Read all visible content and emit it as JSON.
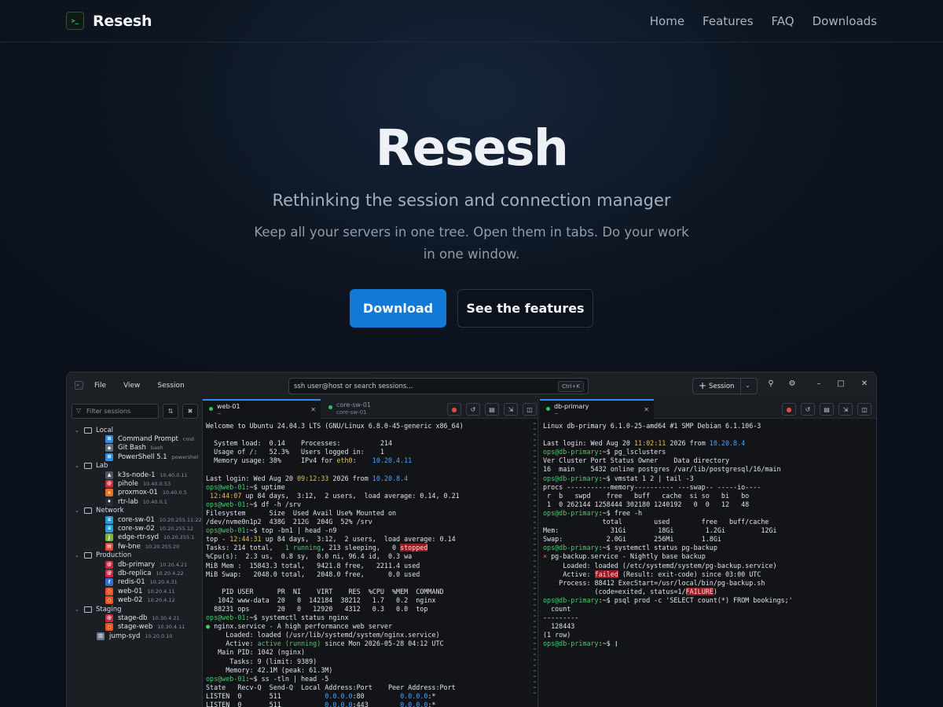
{
  "nav": {
    "brand": "Resesh",
    "logo_glyph": ">_",
    "links": [
      "Home",
      "Features",
      "FAQ",
      "Downloads"
    ]
  },
  "hero": {
    "title": "Resesh",
    "subtitle": "Rethinking the session and connection manager",
    "description": "Keep all your servers in one tree. Open them in tabs. Do your work in one window.",
    "primary_button": "Download",
    "secondary_button": "See the features"
  },
  "colors": {
    "accent": "#1179d7",
    "prompt_green": "#3ecf6e",
    "path_blue": "#4aa3ff",
    "error_red": "#ff5a5f"
  },
  "app": {
    "menu": [
      "File",
      "View",
      "Session"
    ],
    "search_placeholder": "ssh user@host or search sessions...",
    "search_shortcut": "Ctrl+K",
    "session_button": "Session",
    "toolbar_icons": [
      "pin-icon",
      "gear-icon",
      "minimize-icon",
      "maximize-icon",
      "close-icon"
    ],
    "filter_placeholder": "Filter sessions",
    "tree": [
      {
        "type": "group",
        "name": "Local"
      },
      {
        "type": "item",
        "name": "Command Prompt",
        "detail": "cmd",
        "icon": "windows-icon",
        "color": "#2f8be6"
      },
      {
        "type": "item",
        "name": "Git Bash",
        "detail": "bash",
        "icon": "git-bash-icon",
        "color": "#5f7186"
      },
      {
        "type": "item",
        "name": "PowerShell 5.1",
        "detail": "powershel",
        "icon": "windows-icon",
        "color": "#2f8be6"
      },
      {
        "type": "group",
        "name": "Lab"
      },
      {
        "type": "item",
        "name": "k3s-node-1",
        "detail": "10.40.0.11",
        "icon": "linux-icon",
        "color": "#4c5563"
      },
      {
        "type": "item",
        "name": "pihole",
        "detail": "10.40.0.53",
        "icon": "debian-icon",
        "color": "#c8283f"
      },
      {
        "type": "item",
        "name": "proxmox-01",
        "detail": "10.40.0.5",
        "icon": "proxmox-icon",
        "color": "#e8711f"
      },
      {
        "type": "item",
        "name": "rtr-lab",
        "detail": "10.40.0.1",
        "icon": "bsd-icon",
        "color": "#2a2d33"
      },
      {
        "type": "group",
        "name": "Network"
      },
      {
        "type": "item",
        "name": "core-sw-01",
        "detail": "10.20.255.11:22",
        "icon": "switch-icon",
        "color": "#2a9ad8"
      },
      {
        "type": "item",
        "name": "core-sw-02",
        "detail": "10.20.255.12",
        "icon": "switch-icon",
        "color": "#2a9ad8"
      },
      {
        "type": "item",
        "name": "edge-rtr-syd",
        "detail": "10.20.255.1",
        "icon": "juniper-icon",
        "color": "#7bb241"
      },
      {
        "type": "item",
        "name": "fw-bne",
        "detail": "10.20.255.20",
        "icon": "firewall-icon",
        "color": "#e2483c"
      },
      {
        "type": "group",
        "name": "Production"
      },
      {
        "type": "item",
        "name": "db-primary",
        "detail": "10.20.4.21",
        "icon": "debian-icon",
        "color": "#c8283f"
      },
      {
        "type": "item",
        "name": "db-replica",
        "detail": "10.20.4.22",
        "icon": "debian-icon",
        "color": "#c8283f"
      },
      {
        "type": "item",
        "name": "redis-01",
        "detail": "10.20.4.31",
        "icon": "fedora-icon",
        "color": "#2e6fd1"
      },
      {
        "type": "item",
        "name": "web-01",
        "detail": "10.20.4.11",
        "icon": "ubuntu-icon",
        "color": "#e95420"
      },
      {
        "type": "item",
        "name": "web-02",
        "detail": "10.20.4.12",
        "icon": "ubuntu-icon",
        "color": "#e95420"
      },
      {
        "type": "group",
        "name": "Staging"
      },
      {
        "type": "item",
        "name": "stage-db",
        "detail": "10.30.4.21",
        "icon": "debian-icon",
        "color": "#c8283f"
      },
      {
        "type": "item",
        "name": "stage-web",
        "detail": "10.30.4.11",
        "icon": "ubuntu-icon",
        "color": "#e95420"
      },
      {
        "type": "item",
        "name": "jump-syd",
        "detail": "10.20.0.10",
        "icon": "server-icon",
        "color": "#6b7b90"
      }
    ],
    "left_tabs": [
      {
        "name": "web-01",
        "sub": "~",
        "active": true
      },
      {
        "name": "core-sw-01",
        "sub": "core-sw-01",
        "active": false
      }
    ],
    "right_tabs": [
      {
        "name": "db-primary",
        "sub": "~",
        "active": true
      }
    ],
    "left_terminal": [
      [
        [
          "Welcome to Ubuntu 24.04.3 LTS (GNU/Linux 6.8.0-45-generic x86_64)",
          ""
        ]
      ],
      [
        [
          "",
          ""
        ]
      ],
      [
        [
          "  System load:  0.14    Processes:          214",
          ""
        ]
      ],
      [
        [
          "  Usage of /:   52.3%   Users logged in:    1",
          ""
        ]
      ],
      [
        [
          "  Memory usage: 38%     IPv4 for ",
          ""
        ],
        [
          "eth0",
          "y"
        ],
        [
          ":    ",
          ""
        ],
        [
          "10.20.4.11",
          "b"
        ]
      ],
      [
        [
          "",
          ""
        ]
      ],
      [
        [
          "Last login: Wed Aug 20 ",
          ""
        ],
        [
          "09:12:33",
          "y"
        ],
        [
          " 2026 from ",
          ""
        ],
        [
          "10.20.8.4",
          "b"
        ]
      ],
      [
        [
          "ops@web-01",
          "g"
        ],
        [
          ":~$ uptime",
          ""
        ]
      ],
      [
        [
          " 12:44:07 ",
          "y"
        ],
        [
          "up 84 days,  3:12,  2 users,  load average: 0.14, 0.21",
          ""
        ]
      ],
      [
        [
          "ops@web-01",
          "g"
        ],
        [
          ":~$ df -h /srv",
          ""
        ]
      ],
      [
        [
          "Filesystem      Size  Used Avail Use% Mounted on",
          ""
        ]
      ],
      [
        [
          "/dev/nvme0n1p2  438G  212G  204G  52% /srv",
          ""
        ]
      ],
      [
        [
          "ops@web-01",
          "g"
        ],
        [
          ":~$ top -bn1 | head -n9",
          ""
        ]
      ],
      [
        [
          "top - ",
          ""
        ],
        [
          "12:44:31",
          "y"
        ],
        [
          " up 84 days,  3:12,  2 users,  load average: 0.14",
          ""
        ]
      ],
      [
        [
          "Tasks: 214 total,   ",
          ""
        ],
        [
          "1 running",
          "g"
        ],
        [
          ", 213 sleeping,   0 ",
          ""
        ],
        [
          "stopped",
          "rb"
        ]
      ],
      [
        [
          "%Cpu(s):  2.3 us,  0.8 sy,  0.0 ni, 96.4 id,  0.3 wa",
          ""
        ]
      ],
      [
        [
          "MiB Mem :  15843.3 total,   9421.8 free,   2211.4 used",
          ""
        ]
      ],
      [
        [
          "MiB Swap:   2048.0 total,   2048.0 free,      0.0 used",
          ""
        ]
      ],
      [
        [
          "",
          ""
        ]
      ],
      [
        [
          "    PID USER      PR  NI    VIRT    RES  %CPU  %MEM  COMMAND",
          ""
        ]
      ],
      [
        [
          "   1042 www-data  20   0  142184  38212   1.7   0.2  nginx",
          ""
        ]
      ],
      [
        [
          "  88231 ops       20   0   12920   4312   0.3   0.0  top",
          ""
        ]
      ],
      [
        [
          "ops@web-01",
          "g"
        ],
        [
          ":~$ systemctl status nginx",
          ""
        ]
      ],
      [
        [
          "●",
          "g"
        ],
        [
          " nginx.service - A high performance web server",
          ""
        ]
      ],
      [
        [
          "     Loaded: loaded (/usr/lib/systemd/system/nginx.service)",
          ""
        ]
      ],
      [
        [
          "     Active: ",
          ""
        ],
        [
          "active (running)",
          "g"
        ],
        [
          " since Mon 2026-05-28 04:12 UTC",
          ""
        ]
      ],
      [
        [
          "   Main PID: 1042 (nginx)",
          ""
        ]
      ],
      [
        [
          "      Tasks: 9 (limit: 9389)",
          ""
        ]
      ],
      [
        [
          "     Memory: 42.1M (peak: 61.3M)",
          ""
        ]
      ],
      [
        [
          "ops@web-01",
          "g"
        ],
        [
          ":~$ ss -tln | head -5",
          ""
        ]
      ],
      [
        [
          "State   Recv-Q  Send-Q  Local Address:Port    Peer Address:Port",
          ""
        ]
      ],
      [
        [
          "LISTEN  0       511           ",
          ""
        ],
        [
          "0.0.0.0",
          "b"
        ],
        [
          ":80         ",
          ""
        ],
        [
          "0.0.0.0",
          "b"
        ],
        [
          ":*",
          ""
        ]
      ],
      [
        [
          "LISTEN  0       511           ",
          ""
        ],
        [
          "0.0.0.0",
          "b"
        ],
        [
          ":443        ",
          ""
        ],
        [
          "0.0.0.0",
          "b"
        ],
        [
          ":*",
          ""
        ]
      ]
    ],
    "right_terminal": [
      [
        [
          "Linux db-primary 6.1.0-25-amd64 #1 SMP Debian 6.1.106-3",
          ""
        ]
      ],
      [
        [
          "",
          ""
        ]
      ],
      [
        [
          "Last login: Wed Aug 20 ",
          ""
        ],
        [
          "11:02:11",
          "y"
        ],
        [
          " 2026 from ",
          ""
        ],
        [
          "10.20.8.4",
          "b"
        ]
      ],
      [
        [
          "ops@db-primary",
          "g"
        ],
        [
          ":~$ pg_lsclusters",
          ""
        ]
      ],
      [
        [
          "Ver Cluster Port Status Owner    Data directory",
          ""
        ]
      ],
      [
        [
          "16  main    5432 online postgres /var/lib/postgresql/16/main",
          ""
        ]
      ],
      [
        [
          "ops@db-primary",
          "g"
        ],
        [
          ":~$ vmstat 1 2 | tail -3",
          ""
        ]
      ],
      [
        [
          "procs -----------memory---------- ---swap-- -----io----",
          ""
        ]
      ],
      [
        [
          " r  b   swpd    free   buff   cache  si so   bi   bo",
          ""
        ]
      ],
      [
        [
          " 1  0 262144 1258444 302180 1240192   0  0   12   48",
          ""
        ]
      ],
      [
        [
          "ops@db-primary",
          "g"
        ],
        [
          ":~$ free -h",
          ""
        ]
      ],
      [
        [
          "               total        used        free   buff/cache",
          ""
        ]
      ],
      [
        [
          "Mem:             31Gi        18Gi        1.2Gi         12Gi",
          ""
        ]
      ],
      [
        [
          "Swap:           2.0Gi       256Mi       1.8Gi",
          ""
        ]
      ],
      [
        [
          "ops@db-primary",
          "g"
        ],
        [
          ":~$ systemctl status pg-backup",
          ""
        ]
      ],
      [
        [
          "×",
          "r"
        ],
        [
          " pg-backup.service - Nightly base backup",
          ""
        ]
      ],
      [
        [
          "     Loaded: loaded (/etc/systemd/system/pg-backup.service)",
          ""
        ]
      ],
      [
        [
          "     Active: ",
          ""
        ],
        [
          "failed",
          "rb"
        ],
        [
          " (Result: exit-code) since 03:00 UTC",
          ""
        ]
      ],
      [
        [
          "    Process: 88412 ExecStart=/usr/local/bin/pg-backup.sh",
          ""
        ]
      ],
      [
        [
          "             (code=exited, status=1/",
          ""
        ],
        [
          "FAILURE",
          "rb"
        ],
        [
          ")",
          ""
        ]
      ],
      [
        [
          "ops@db-primary",
          "g"
        ],
        [
          ":~$ psql prod -c 'SELECT count(*) FROM bookings;'",
          ""
        ]
      ],
      [
        [
          "  count",
          ""
        ]
      ],
      [
        [
          "---------",
          ""
        ]
      ],
      [
        [
          "  128443",
          ""
        ]
      ],
      [
        [
          "(1 row)",
          ""
        ]
      ],
      [
        [
          "ops@db-primary",
          "g"
        ],
        [
          ":~$ ",
          ""
        ],
        [
          "❙",
          "dim"
        ]
      ]
    ]
  }
}
